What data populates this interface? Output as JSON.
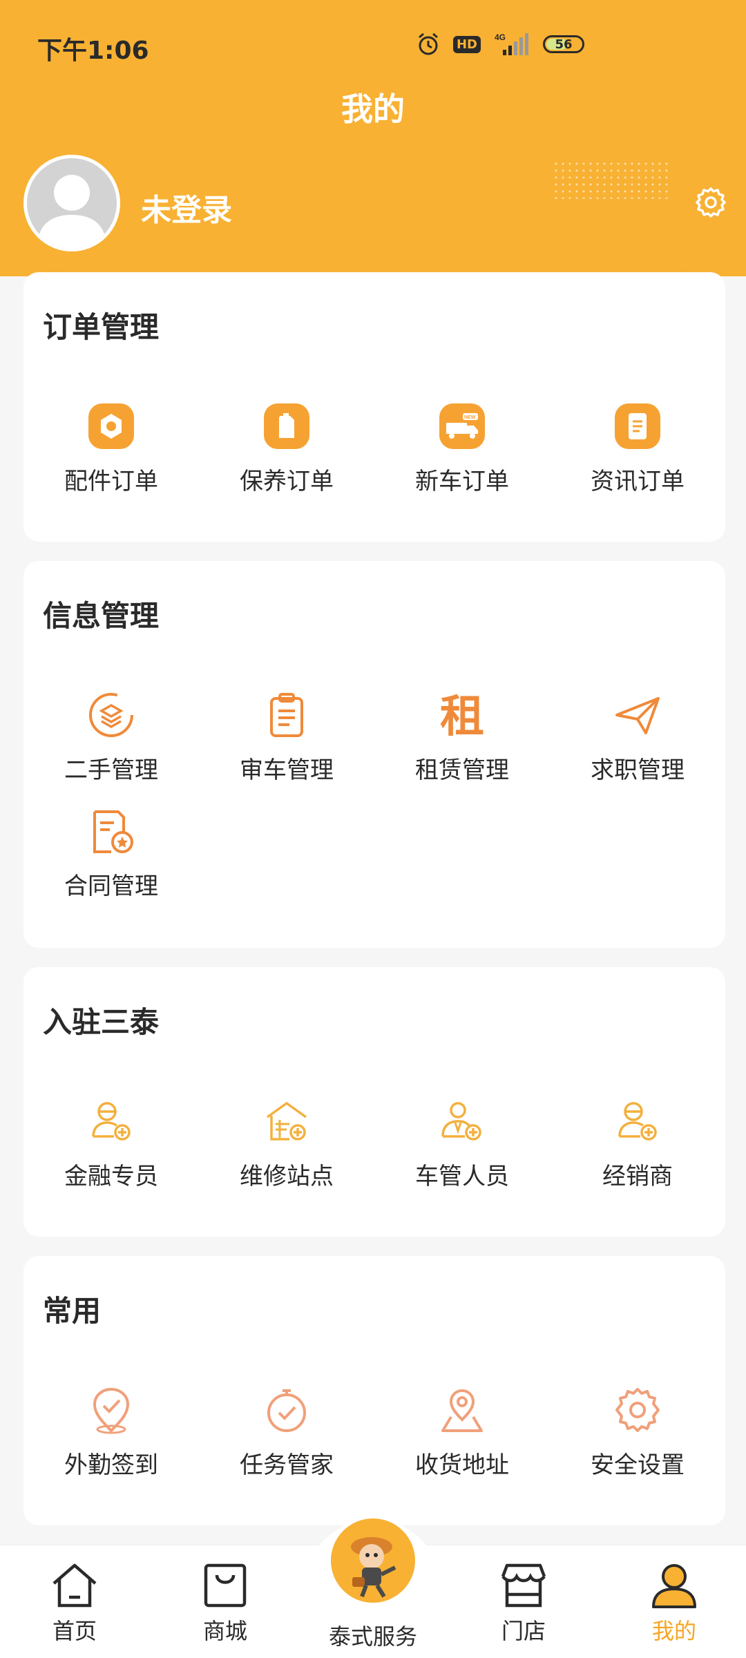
{
  "status_bar": {
    "time": "下午1:06",
    "network": "4G",
    "hd": "HD",
    "battery": "56"
  },
  "header": {
    "title": "我的",
    "login_text": "未登录",
    "brand_color": "#f8b133"
  },
  "sections": [
    {
      "title": "订单管理",
      "items": [
        {
          "label": "配件订单",
          "icon": "hexagon-nut-icon"
        },
        {
          "label": "保养订单",
          "icon": "oil-can-icon"
        },
        {
          "label": "新车订单",
          "icon": "new-truck-icon"
        },
        {
          "label": "资讯订单",
          "icon": "document-icon"
        }
      ]
    },
    {
      "title": "信息管理",
      "items": [
        {
          "label": "二手管理",
          "icon": "recycle-layers-icon"
        },
        {
          "label": "审车管理",
          "icon": "clipboard-icon"
        },
        {
          "label": "租赁管理",
          "icon": "rent-character-icon",
          "glyph": "租"
        },
        {
          "label": "求职管理",
          "icon": "paper-plane-icon"
        },
        {
          "label": "合同管理",
          "icon": "contract-star-icon"
        }
      ]
    },
    {
      "title": "入驻三泰",
      "items": [
        {
          "label": "金融专员",
          "icon": "worker-add-icon"
        },
        {
          "label": "维修站点",
          "icon": "station-add-icon"
        },
        {
          "label": "车管人员",
          "icon": "manager-add-icon"
        },
        {
          "label": "经销商",
          "icon": "dealer-add-icon"
        }
      ]
    },
    {
      "title": "常用",
      "items": [
        {
          "label": "外勤签到",
          "icon": "location-check-icon"
        },
        {
          "label": "任务管家",
          "icon": "timer-check-icon"
        },
        {
          "label": "收货地址",
          "icon": "map-pin-icon"
        },
        {
          "label": "安全设置",
          "icon": "gear-icon"
        }
      ]
    }
  ],
  "tab_bar": {
    "tabs": [
      {
        "label": "首页",
        "icon": "home-icon"
      },
      {
        "label": "商城",
        "icon": "shopping-bag-icon"
      },
      {
        "label": "泰式服务",
        "icon": "mascot-icon"
      },
      {
        "label": "门店",
        "icon": "store-icon"
      },
      {
        "label": "我的",
        "icon": "user-icon"
      }
    ],
    "active_color": "#f5a623"
  }
}
